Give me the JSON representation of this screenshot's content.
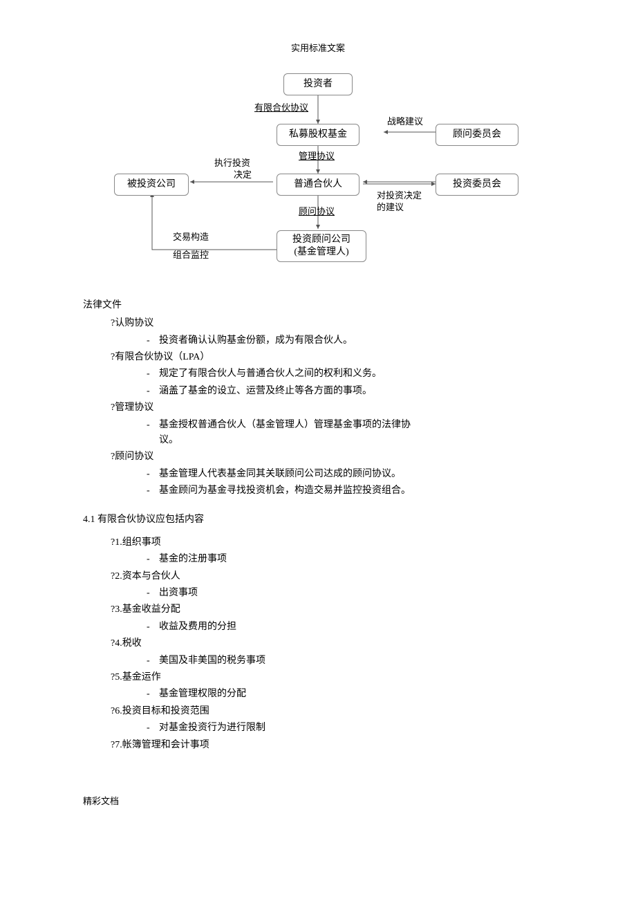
{
  "header": "实用标准文案",
  "footer": "精彩文档",
  "diagram": {
    "boxes": {
      "investor": "投资者",
      "pe_fund": "私募股权基金",
      "advisory_board": "顾问委员会",
      "invested_co": "被投资公司",
      "gp": "普通合伙人",
      "inv_committee": "投资委员会",
      "advisor_co_l1": "投资顾问公司",
      "advisor_co_l2": "(基金管理人)"
    },
    "edges": {
      "lpa": "有限合伙协议",
      "mgmt": "管理协议",
      "advisor_agr": "顾问协议",
      "strategy": "战略建议",
      "exec_inv_l1": "执行投资",
      "exec_inv_l2": "决定",
      "inv_advice_l1": "对投资决定",
      "inv_advice_l2": "的建议",
      "deal_struct": "交易构造",
      "portfolio_mon": "组合监控"
    }
  },
  "body": {
    "legal_docs_title": "法律文件",
    "items": [
      {
        "label": "认购协议",
        "subs": [
          "投资者确认认购基金份额，成为有限合伙人。"
        ]
      },
      {
        "label": "有限合伙协议（LPA）",
        "subs": [
          "规定了有限合伙人与普通合伙人之间的权利和义务。",
          "涵盖了基金的设立、运营及终止等各方面的事项。"
        ]
      },
      {
        "label": "管理协议",
        "subs": [
          "基金授权普通合伙人（基金管理人）管理基金事项的法律协议。"
        ]
      },
      {
        "label": "顾问协议",
        "subs": [
          "基金管理人代表基金同其关联顾问公司达成的顾问协议。",
          "基金顾问为基金寻找投资机会，构造交易并监控投资组合。"
        ]
      }
    ],
    "section_41": "4.1 有限合伙协议应包括内容",
    "list41": [
      {
        "label": "1.组织事项",
        "subs": [
          "基金的注册事项"
        ]
      },
      {
        "label": "2.资本与合伙人",
        "subs": [
          "出资事项"
        ]
      },
      {
        "label": "3.基金收益分配",
        "subs": [
          "收益及费用的分担"
        ]
      },
      {
        "label": "4.税收",
        "subs": [
          "美国及非美国的税务事项"
        ]
      },
      {
        "label": "5.基金运作",
        "subs": [
          "基金管理权限的分配"
        ]
      },
      {
        "label": "6.投资目标和投资范围",
        "subs": [
          "对基金投资行为进行限制"
        ]
      },
      {
        "label": "7.帐簿管理和会计事项",
        "subs": []
      }
    ]
  }
}
